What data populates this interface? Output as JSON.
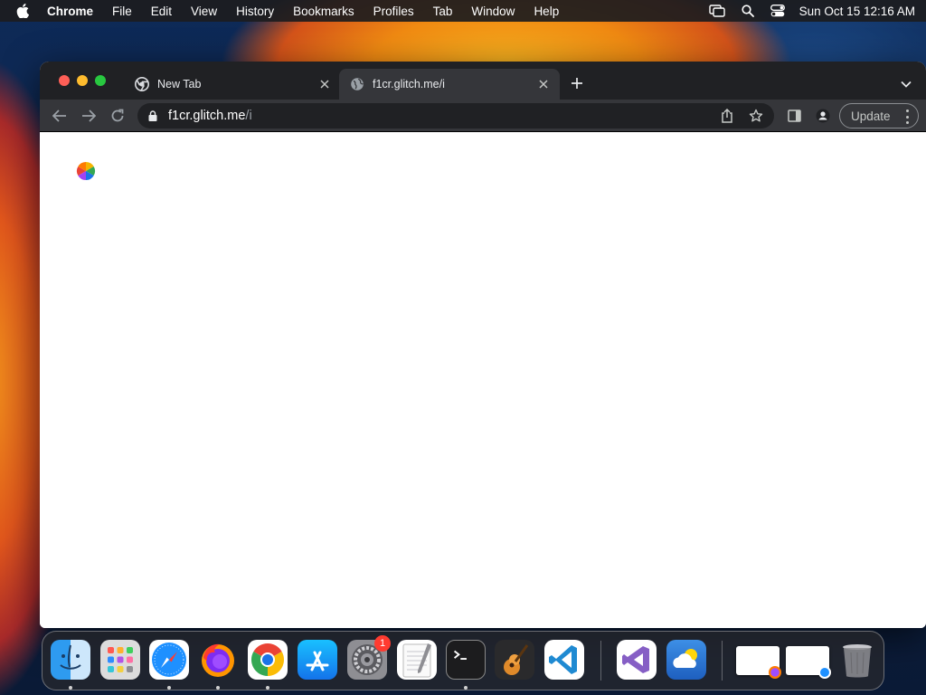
{
  "menubar": {
    "app_name": "Chrome",
    "items": [
      "File",
      "Edit",
      "View",
      "History",
      "Bookmarks",
      "Profiles",
      "Tab",
      "Window",
      "Help"
    ],
    "clock": "Sun Oct 15  12:16 AM"
  },
  "browser": {
    "tabs": [
      {
        "title": "New Tab",
        "active": false,
        "icon": "chrome-icon"
      },
      {
        "title": "f1cr.glitch.me/i",
        "active": true,
        "icon": "globe-icon"
      }
    ],
    "address": {
      "host": "f1cr.glitch.me",
      "path": "/i"
    },
    "update_label": "Update",
    "page_state": "loading"
  },
  "dock": {
    "apps": [
      {
        "name": "finder",
        "running": true
      },
      {
        "name": "launchpad",
        "running": false
      },
      {
        "name": "safari",
        "running": true
      },
      {
        "name": "firefox",
        "running": true
      },
      {
        "name": "chrome",
        "running": true
      },
      {
        "name": "app-store",
        "running": false
      },
      {
        "name": "system-preferences",
        "running": false,
        "badge": "1"
      },
      {
        "name": "textedit",
        "running": false
      },
      {
        "name": "terminal",
        "running": true
      },
      {
        "name": "garageband",
        "running": false
      },
      {
        "name": "vscode",
        "running": false
      },
      {
        "name": "visual-studio",
        "running": false
      },
      {
        "name": "weather",
        "running": false
      }
    ],
    "system_pref_badge": "1"
  },
  "colors": {
    "tabstrip": "#202124",
    "toolbar": "#35363a",
    "accent_red": "#fe5f57",
    "accent_yellow": "#febc2e",
    "accent_green": "#28c840"
  }
}
